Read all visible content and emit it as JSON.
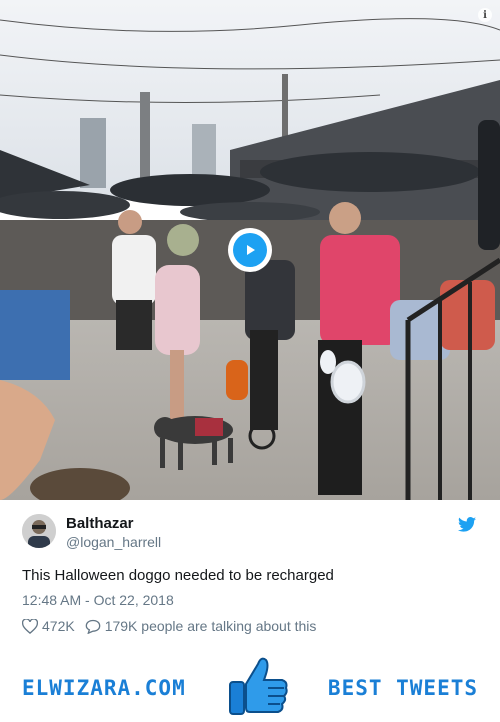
{
  "media": {
    "kind": "video",
    "play_icon": "play-icon",
    "info_icon": "info-icon",
    "info_glyph": "i"
  },
  "tweet": {
    "author": {
      "name": "Balthazar",
      "handle": "@logan_harrell",
      "avatar_icon": "avatar"
    },
    "platform_icon": "twitter-bird-icon",
    "text": "This Halloween doggo needed to be recharged",
    "timestamp": "12:48 AM - Oct 22, 2018",
    "likes": "472K",
    "talking": "179K people are talking about this",
    "colors": {
      "text": "#14171a",
      "secondary": "#657786",
      "accent": "#1da1f2"
    }
  },
  "footer": {
    "brand": "ELWIZARA.COM",
    "tagline": "BEST TWEETS",
    "logo_icon": "thumbs-up-icon",
    "brand_color": "#1a7fd6"
  }
}
